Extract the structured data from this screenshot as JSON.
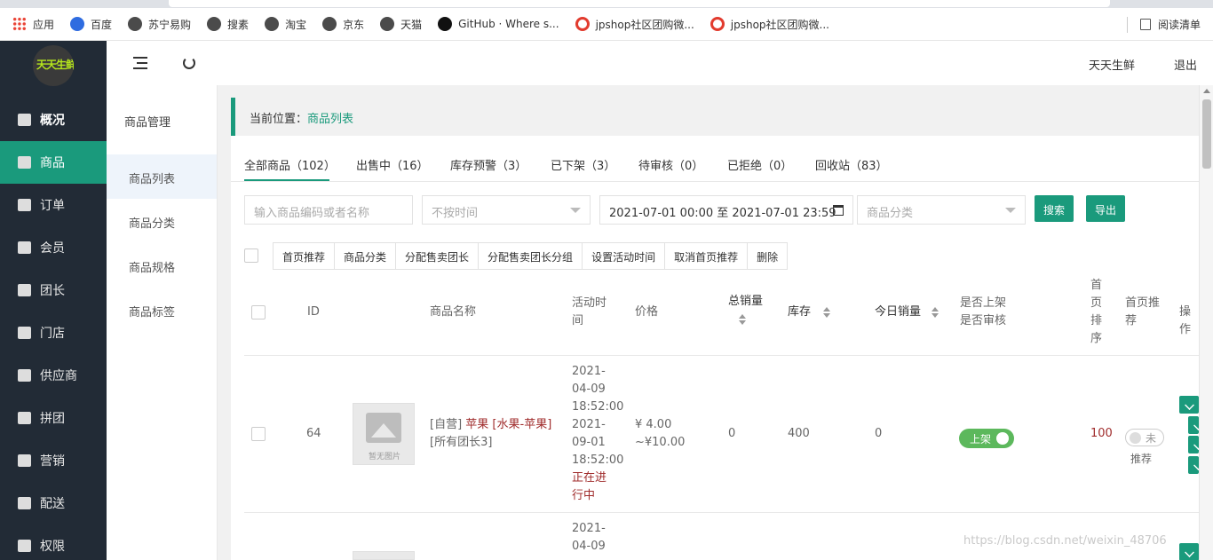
{
  "bookmarks": {
    "items": [
      {
        "icon": "apps-icon",
        "label": "应用"
      },
      {
        "icon": "baidu-paw-icon",
        "label": "百度"
      },
      {
        "icon": "globe-icon",
        "label": "苏宁易购"
      },
      {
        "icon": "globe-icon",
        "label": "搜素"
      },
      {
        "icon": "globe-icon",
        "label": "淘宝"
      },
      {
        "icon": "globe-icon",
        "label": "京东"
      },
      {
        "icon": "globe-icon",
        "label": "天猫"
      },
      {
        "icon": "github-icon",
        "label": "GitHub · Where s..."
      },
      {
        "icon": "jpshop-icon",
        "label": "jpshop社区团购微..."
      },
      {
        "icon": "jpshop-icon",
        "label": "jpshop社区团购微..."
      }
    ],
    "reading_list": "阅读清单"
  },
  "logo_text": "天天生鲜",
  "nav": [
    {
      "label": "概况",
      "icon": "home-icon"
    },
    {
      "label": "商品",
      "icon": "goods-icon"
    },
    {
      "label": "订单",
      "icon": "order-icon"
    },
    {
      "label": "会员",
      "icon": "member-icon"
    },
    {
      "label": "团长",
      "icon": "leader-icon"
    },
    {
      "label": "门店",
      "icon": "store-icon"
    },
    {
      "label": "供应商",
      "icon": "supplier-icon"
    },
    {
      "label": "拼团",
      "icon": "groupbuy-icon"
    },
    {
      "label": "营销",
      "icon": "gift-icon"
    },
    {
      "label": "配送",
      "icon": "truck-icon"
    },
    {
      "label": "权限",
      "icon": "lock-icon"
    }
  ],
  "subnav": {
    "title": "商品管理",
    "items": [
      "商品列表",
      "商品分类",
      "商品规格",
      "商品标签"
    ]
  },
  "header": {
    "user": "天天生鲜",
    "logout": "退出"
  },
  "breadcrumb": {
    "prefix": "当前位置：",
    "current": "商品列表"
  },
  "tabs": [
    "全部商品（102）",
    "出售中（16）",
    "库存预警（3）",
    "已下架（3）",
    "待审核（0）",
    "已拒绝（0）",
    "回收站（83）"
  ],
  "filters": {
    "keyword_placeholder": "输入商品编码或者名称",
    "time_select": "不按时间",
    "date_range": "2021-07-01 00:00 至 2021-07-01 23:59",
    "category_select": "商品分类",
    "search_btn": "搜索",
    "export_btn": "导出"
  },
  "batch_actions": [
    "首页推荐",
    "商品分类",
    "分配售卖团长",
    "分配售卖团长分组",
    "设置活动时间",
    "取消首页推荐",
    "删除"
  ],
  "table": {
    "headers": {
      "id": "ID",
      "name": "商品名称",
      "time_l1": "活动时",
      "time_l2": "间",
      "price": "价格",
      "total_sales": "总销量",
      "stock": "库存",
      "today_sales": "今日销量",
      "onshelf": "是否上架",
      "audit": "是否审核",
      "sort_1": "首",
      "sort_2": "页",
      "sort_3": "排",
      "sort_4": "序",
      "home_1": "首页推",
      "home_2": "荐",
      "ops": "操作"
    },
    "rows": [
      {
        "id": "64",
        "image_caption": "暂无图片",
        "name_prefix": "[自营]",
        "name_main": "苹果 [水果-苹果]",
        "name_suffix": "[所有团长3]",
        "t1": "2021-",
        "t2": "04-09",
        "t3": "18:52:00",
        "t4": "2021-",
        "t5": "09-01",
        "t6": "18:52:00",
        "status_1": "正在进",
        "status_2": "行中",
        "price_1": "¥ 4.00",
        "price_2": "~¥10.00",
        "total_sales": "0",
        "stock": "400",
        "today_sales": "0",
        "onshelf": "上架",
        "sort": "100",
        "home_toggle": "未",
        "home_label": "推荐"
      },
      {
        "t1": "2021-",
        "t2": "04-09"
      }
    ]
  },
  "watermark": "https://blog.csdn.net/weixin_48706"
}
